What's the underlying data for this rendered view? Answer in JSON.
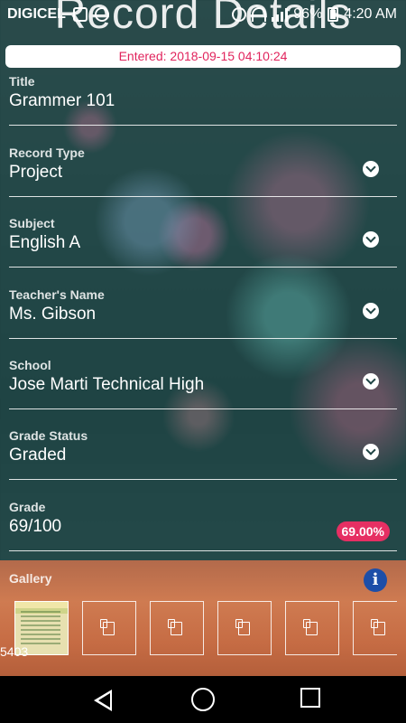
{
  "status_bar": {
    "carrier": "DIGICEL",
    "battery": "96%",
    "time": "4:20 AM"
  },
  "page_title": "Record Details",
  "entered": "Entered: 2018-09-15 04:10:24",
  "fields": [
    {
      "label": "Title",
      "value": "Grammer 101"
    },
    {
      "label": "Record Type",
      "value": "Project"
    },
    {
      "label": "Subject",
      "value": "English A"
    },
    {
      "label": "Teacher's Name",
      "value": "Ms. Gibson"
    },
    {
      "label": "School",
      "value": "Jose Marti Technical High"
    },
    {
      "label": "Grade Status",
      "value": "Graded"
    },
    {
      "label": "Grade",
      "value": "69/100",
      "badge": "69.00%"
    }
  ],
  "gallery": {
    "label": "Gallery",
    "caption": "5403"
  },
  "colors": {
    "accent": "#e62f63",
    "info": "#1d4ea8"
  }
}
